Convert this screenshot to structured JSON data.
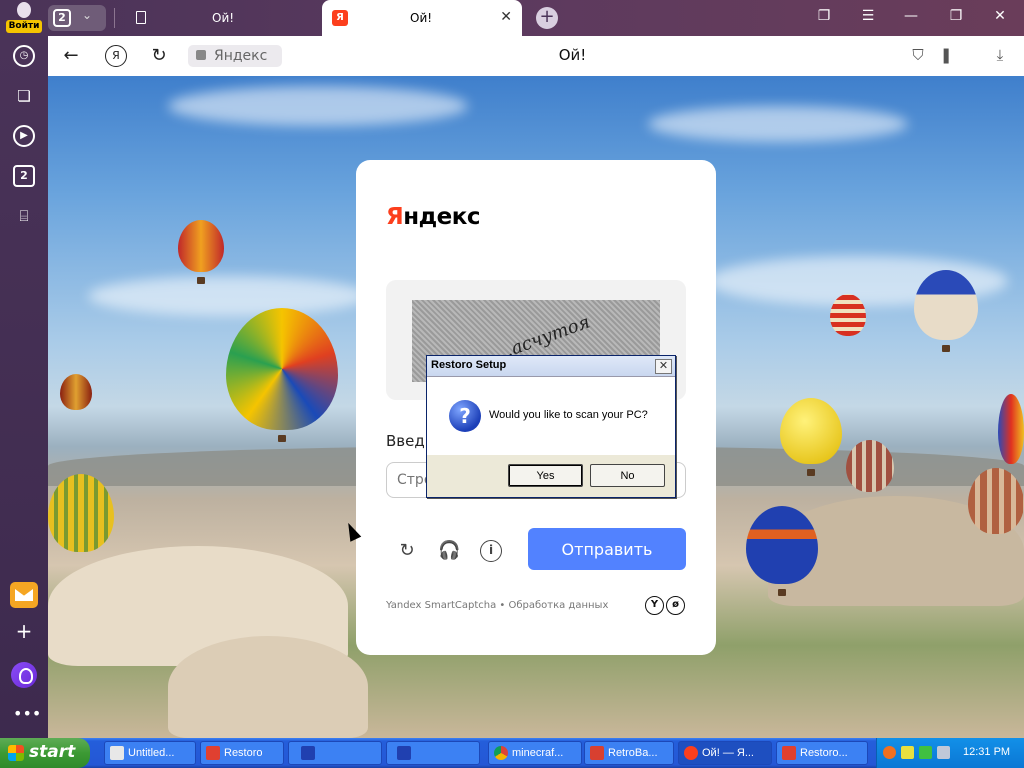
{
  "browser": {
    "tab_count": "2",
    "sidebar_login": "Войти",
    "sidebar_badge": "2",
    "tabs": [
      {
        "label": "Ой!"
      },
      {
        "label": "Ой!",
        "favicon": "Я"
      }
    ],
    "address": {
      "url_text": "Яндекс",
      "page_title": "Ой!",
      "ya_button": "Я"
    }
  },
  "captcha": {
    "logo_first": "Я",
    "logo_rest": "ндекс",
    "image_text": "…асчутоя",
    "input_label": "Введи",
    "input_placeholder": "Стро",
    "submit_label": "Отправить",
    "footer": "Yandex SmartCaptcha • Обработка данных",
    "footer_logo_1": "Y",
    "footer_logo_2": "ø"
  },
  "dialog": {
    "title": "Restoro Setup",
    "message": "Would you like to scan your PC?",
    "yes_label": "Yes",
    "no_label": "No"
  },
  "taskbar": {
    "start_label": "start",
    "items": [
      {
        "label": "Untitled..."
      },
      {
        "label": "Restoro"
      },
      {
        "label": ""
      },
      {
        "label": ""
      },
      {
        "label": "minecraf..."
      },
      {
        "label": "RetroBa..."
      },
      {
        "label": "Ой! — Я..."
      },
      {
        "label": "Restoro..."
      }
    ],
    "clock": "12:31 PM"
  },
  "colors": {
    "yandex_red": "#fc3f1d",
    "submit_blue": "#5282ff",
    "xp_taskbar": "#245edb",
    "xp_start_green": "#3c9a34"
  }
}
